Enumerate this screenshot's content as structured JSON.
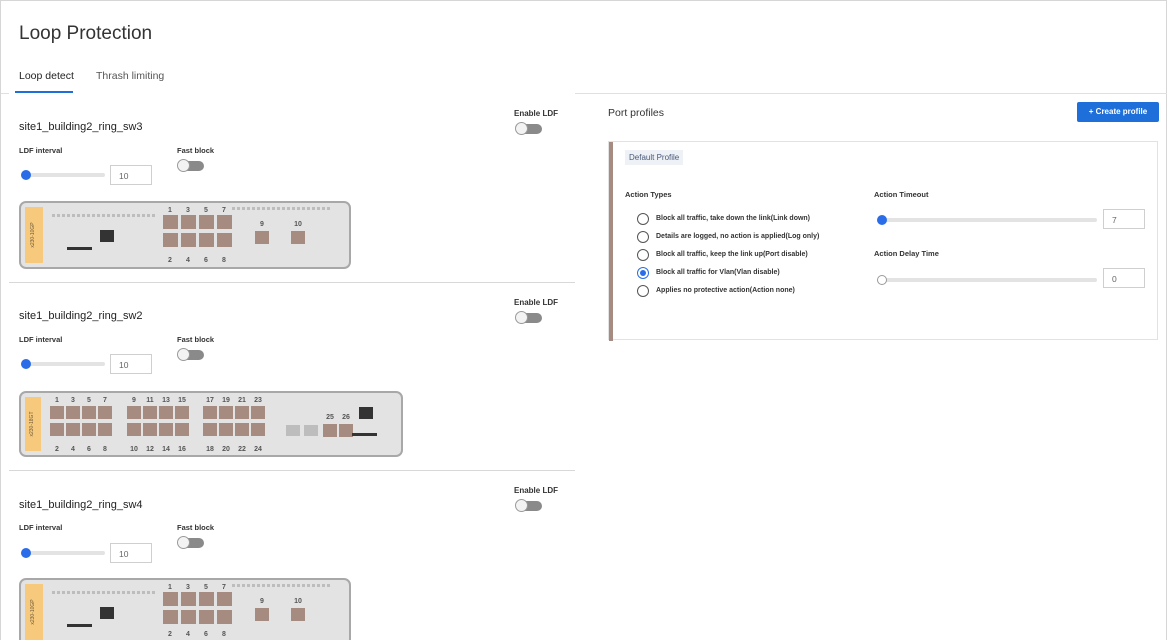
{
  "page": {
    "title": "Loop Protection"
  },
  "tabs": [
    {
      "label": "Loop detect",
      "active": true
    },
    {
      "label": "Thrash limiting",
      "active": false
    }
  ],
  "switches": [
    {
      "name": "site1_building2_ring_sw3",
      "enable_ldf_label": "Enable LDF",
      "enable_ldf": false,
      "ldf_interval_label": "LDF interval",
      "ldf_interval": "10",
      "fast_block_label": "Fast block",
      "fast_block": false,
      "device_model": "x230-10GP",
      "port_top": [
        "1",
        "3",
        "5",
        "7"
      ],
      "port_bottom": [
        "2",
        "4",
        "6",
        "8"
      ],
      "sfp_ports": [
        "9",
        "10"
      ]
    },
    {
      "name": "site1_building2_ring_sw2",
      "enable_ldf_label": "Enable LDF",
      "enable_ldf": false,
      "ldf_interval_label": "LDF interval",
      "ldf_interval": "10",
      "fast_block_label": "Fast block",
      "fast_block": false,
      "device_model": "x230-18GT",
      "port_top": [
        "1",
        "3",
        "5",
        "7",
        "9",
        "11",
        "13",
        "15",
        "17",
        "19",
        "21",
        "23"
      ],
      "port_bottom": [
        "2",
        "4",
        "6",
        "8",
        "10",
        "12",
        "14",
        "16",
        "18",
        "20",
        "22",
        "24"
      ],
      "sfp_ports": [
        "25",
        "26"
      ]
    },
    {
      "name": "site1_building2_ring_sw4",
      "enable_ldf_label": "Enable LDF",
      "enable_ldf": false,
      "ldf_interval_label": "LDF interval",
      "ldf_interval": "10",
      "fast_block_label": "Fast block",
      "fast_block": false,
      "device_model": "x230-10GP",
      "port_top": [
        "1",
        "3",
        "5",
        "7"
      ],
      "port_bottom": [
        "2",
        "4",
        "6",
        "8"
      ],
      "sfp_ports": [
        "9",
        "10"
      ]
    }
  ],
  "port_profiles": {
    "title": "Port profiles",
    "create_label": "+ Create profile",
    "profile": {
      "name": "Default Profile",
      "action_types_label": "Action Types",
      "options": [
        {
          "label": "Block all traffic, take down the link(Link down)",
          "selected": false
        },
        {
          "label": "Details are logged, no action is applied(Log only)",
          "selected": false
        },
        {
          "label": "Block all traffic, keep the link up(Port disable)",
          "selected": false
        },
        {
          "label": "Block all traffic for Vlan(Vlan disable)",
          "selected": true
        },
        {
          "label": "Applies no protective action(Action none)",
          "selected": false
        }
      ],
      "timeout_label": "Action Timeout",
      "timeout_value": "7",
      "delay_label": "Action Delay Time",
      "delay_value": "0"
    }
  },
  "colors": {
    "accent": "#1e6fd9",
    "port": "#a68b81",
    "device_tag": "#f7c97d",
    "profile_bar": "#a68b81"
  }
}
